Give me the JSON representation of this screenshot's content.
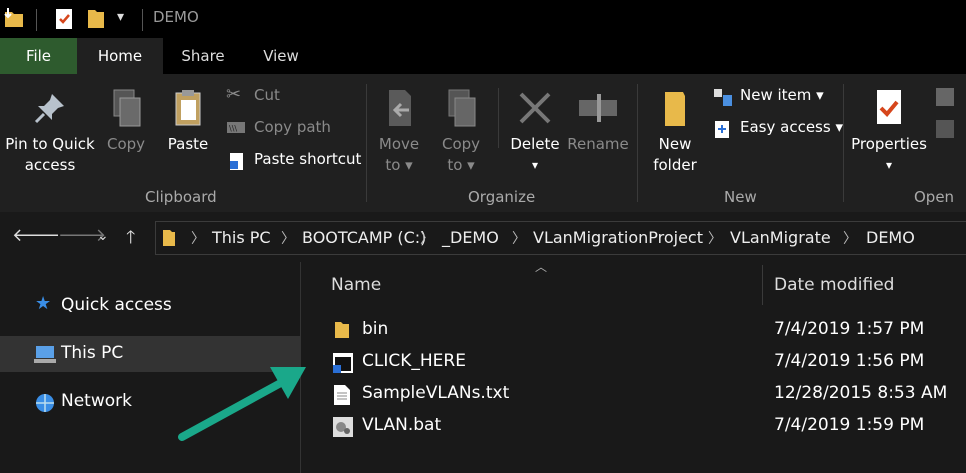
{
  "titlebar": {
    "title": "DEMO"
  },
  "tabs": [
    {
      "label": "File"
    },
    {
      "label": "Home"
    },
    {
      "label": "Share"
    },
    {
      "label": "View"
    }
  ],
  "ribbon": {
    "clipboard": {
      "pin": "Pin to Quick",
      "pin2": "access",
      "copy": "Copy",
      "paste": "Paste",
      "cut": "Cut",
      "copy_path": "Copy path",
      "paste_shortcut": "Paste shortcut",
      "group": "Clipboard"
    },
    "organize": {
      "move": "Move",
      "move_to": "to",
      "copy": "Copy",
      "copy_to": "to",
      "delete": "Delete",
      "rename": "Rename",
      "group": "Organize"
    },
    "new": {
      "new_folder": "New",
      "new_folder2": "folder",
      "new_item": "New item",
      "easy_access": "Easy access",
      "group": "New"
    },
    "open": {
      "properties": "Properties",
      "group": "Open"
    }
  },
  "address": {
    "crumbs": [
      "This PC",
      "BOOTCAMP (C:)",
      "_DEMO",
      "VLanMigrationProject",
      "VLanMigrate",
      "DEMO"
    ]
  },
  "nav": {
    "items": [
      {
        "label": "Quick access"
      },
      {
        "label": "This PC"
      },
      {
        "label": "Network"
      }
    ]
  },
  "files": {
    "col_name": "Name",
    "col_date": "Date modified",
    "rows": [
      {
        "name": "bin",
        "date": "7/4/2019 1:57 PM",
        "icon": "folder-icon"
      },
      {
        "name": "CLICK_HERE",
        "date": "7/4/2019 1:56 PM",
        "icon": "shortcut-icon"
      },
      {
        "name": "SampleVLANs.txt",
        "date": "12/28/2015 8:53 AM",
        "icon": "text-file-icon"
      },
      {
        "name": "VLAN.bat",
        "date": "7/4/2019 1:59 PM",
        "icon": "batch-file-icon"
      }
    ]
  },
  "colors": {
    "accent_file_tab": "#2e5b2e",
    "folder": "#e8b94a",
    "arrow": "#1aa88a"
  }
}
